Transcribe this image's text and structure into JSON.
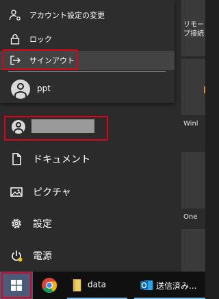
{
  "account_menu": {
    "change_settings": "アカウント設定の変更",
    "lock": "ロック",
    "sign_out": "サインアウト",
    "other_user": "ppt"
  },
  "nav": {
    "documents": "ドキュメント",
    "pictures": "ピクチャ",
    "settings": "設定",
    "power": "電源"
  },
  "tiles": {
    "remote_line1": "リモー",
    "remote_line2": "プ接続",
    "windows": "Winl",
    "onedrive": "One"
  },
  "taskbar": {
    "data_folder": "data",
    "outlook": "送信済み..."
  },
  "colors": {
    "highlight": "#e0001b",
    "start_active": "#4a5a78"
  }
}
